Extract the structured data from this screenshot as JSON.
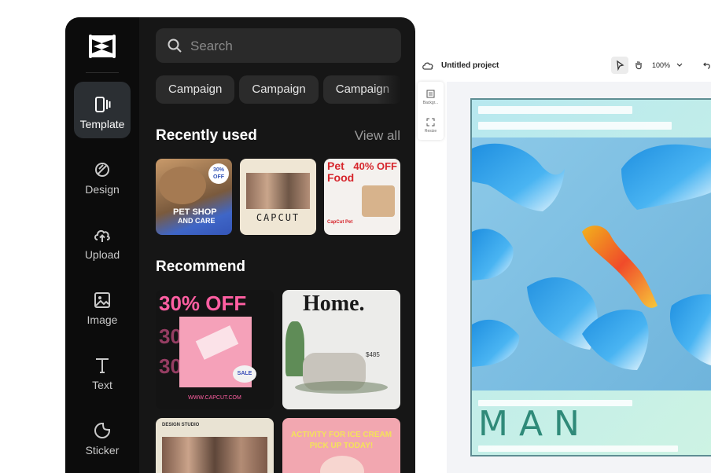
{
  "sidebar": {
    "items": [
      {
        "label": "Template",
        "icon": "template-icon",
        "active": true
      },
      {
        "label": "Design",
        "icon": "design-icon"
      },
      {
        "label": "Upload",
        "icon": "upload-icon"
      },
      {
        "label": "Image",
        "icon": "image-icon"
      },
      {
        "label": "Text",
        "icon": "text-icon"
      },
      {
        "label": "Sticker",
        "icon": "sticker-icon"
      }
    ]
  },
  "search": {
    "placeholder": "Search"
  },
  "chips": [
    "Campaign",
    "Campaign",
    "Campaign"
  ],
  "recently_used": {
    "title": "Recently used",
    "view_all": "View all",
    "cards": [
      {
        "line1": "PET SHOP",
        "line2": "AND CARE",
        "badge": "30% OFF"
      },
      {
        "brand": "CAPCUT"
      },
      {
        "title1": "Pet",
        "title2": "Food",
        "badge": "40% OFF",
        "brand": "CapCut Pet"
      }
    ]
  },
  "recommend": {
    "title": "Recommend",
    "cards": [
      {
        "headline": "30% OFF",
        "badge": "SALE",
        "url": "WWW.CAPCUT.COM"
      },
      {
        "headline": "Home.",
        "price": "$485"
      },
      {
        "headline": "DESIGN STUDIO"
      },
      {
        "headline": "ACTIVITY FOR ICE CREAM",
        "sub": "PICK UP TODAY!"
      }
    ]
  },
  "editor": {
    "project_title": "Untitled project",
    "zoom": "100%",
    "side_tools": [
      "Backgr...",
      "Resize"
    ],
    "canvas_text": "M A N"
  },
  "colors": {
    "panel_bg": "#161616",
    "rail_bg": "#0c0c0c",
    "active_nav": "#2b2f33",
    "canvas_card": "#b7e8ef",
    "canvas_text": "#2f8a79"
  }
}
